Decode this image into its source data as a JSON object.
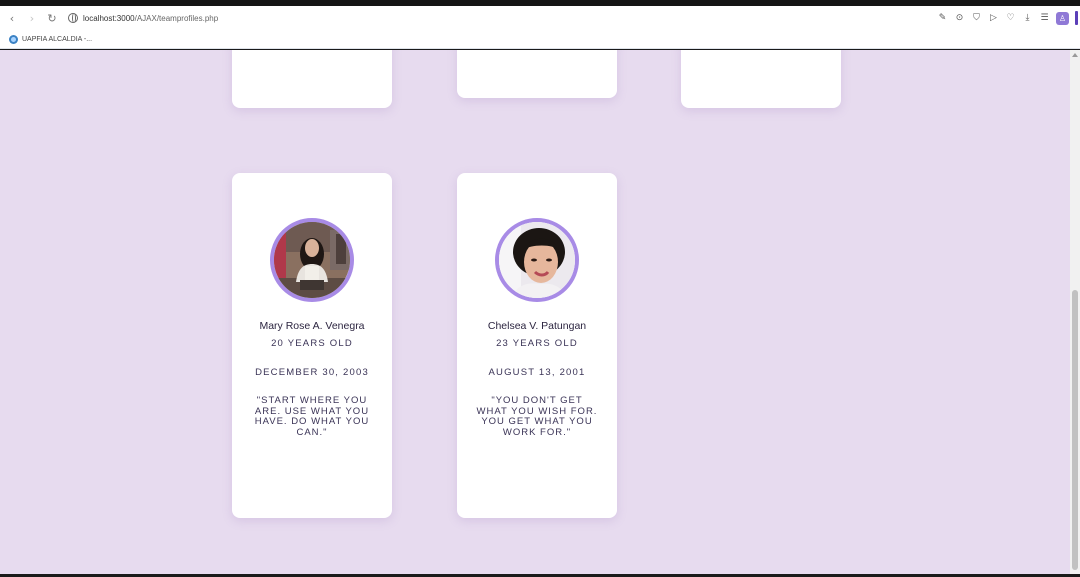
{
  "browser": {
    "url_host": "localhost:3000",
    "url_path": "/AJAX/teamprofiles.php",
    "nav": {
      "back_icon": "‹",
      "forward_icon": "›",
      "reload_icon": "↻"
    },
    "toolbar_icons": [
      "✎",
      "⊙",
      "⛉",
      "▷",
      "♡",
      "⤓",
      "☰"
    ],
    "profile_icon": "♙"
  },
  "bookmarks": {
    "items": [
      {
        "label": "UAPFIA ALCALDIA -..."
      }
    ]
  },
  "colors": {
    "page_background": "#e7dbef",
    "card_background": "#ffffff",
    "avatar_ring": "#a88be6",
    "text": "#3a3356"
  },
  "profiles": [
    {
      "name": "Mary Rose A. Venegra",
      "age": "20 YEARS OLD",
      "birthdate": "DECEMBER 30, 2003",
      "quote": "\"START WHERE YOU ARE. USE WHAT YOU HAVE. DO WHAT YOU CAN.\""
    },
    {
      "name": "Chelsea V. Patungan",
      "age": "23 YEARS OLD",
      "birthdate": "AUGUST 13, 2001",
      "quote": "\"YOU DON'T GET WHAT YOU WISH FOR. YOU GET WHAT YOU WORK FOR.\""
    }
  ]
}
